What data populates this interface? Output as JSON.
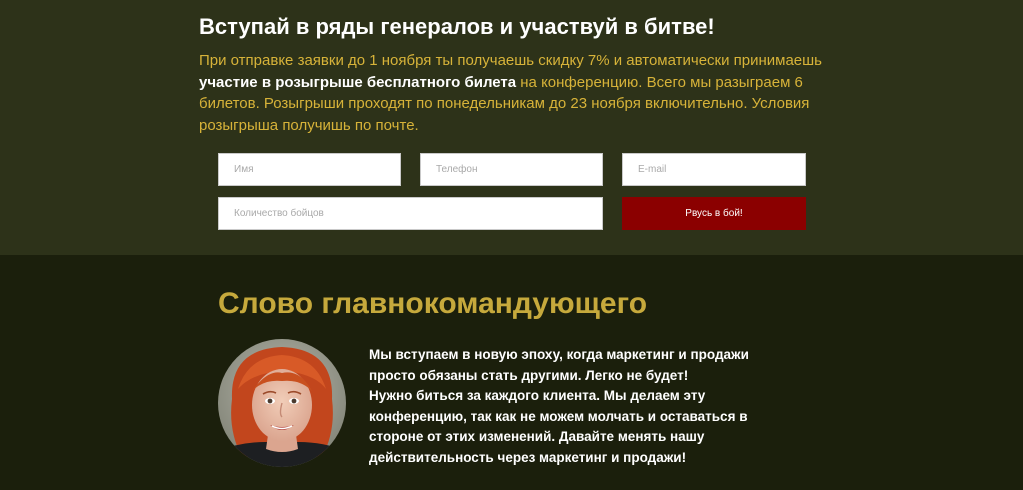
{
  "signup": {
    "title": "Вступай в ряды генералов и участвуй в битве!",
    "desc_part1": "При отправке заявки до 1 ноября ты получаешь скидку 7% и автоматически принимаешь ",
    "desc_bold": "участие в розыгрыше бесплатного билета",
    "desc_part2": " на конференцию. Всего мы разыграем 6 билетов. Розыгрыши проходят по понедельникам до 23 ноября включительно. Условия розыгрыша получишь по почте.",
    "form": {
      "name_placeholder": "Имя",
      "phone_placeholder": "Телефон",
      "email_placeholder": "E-mail",
      "count_placeholder": "Количество бойцов",
      "submit_label": "Рвусь в бой!"
    }
  },
  "commander": {
    "title": "Слово главнокомандующего",
    "quote_line1": "Мы вступаем в новую эпоху, когда маркетинг и продажи просто обязаны стать другими. Легко не будет!",
    "quote_line2": "Нужно биться за каждого клиента. Мы делаем эту конференцию, так как не можем молчать и оставаться в стороне от этих изменений. Давайте менять нашу действительность через маркетинг и продажи!"
  },
  "colors": {
    "top_bg": "#2d3219",
    "bottom_bg": "#1b1f0c",
    "accent_gold": "#d7b339",
    "heading_gold": "#c6a93c",
    "button_red": "#8b0000"
  }
}
